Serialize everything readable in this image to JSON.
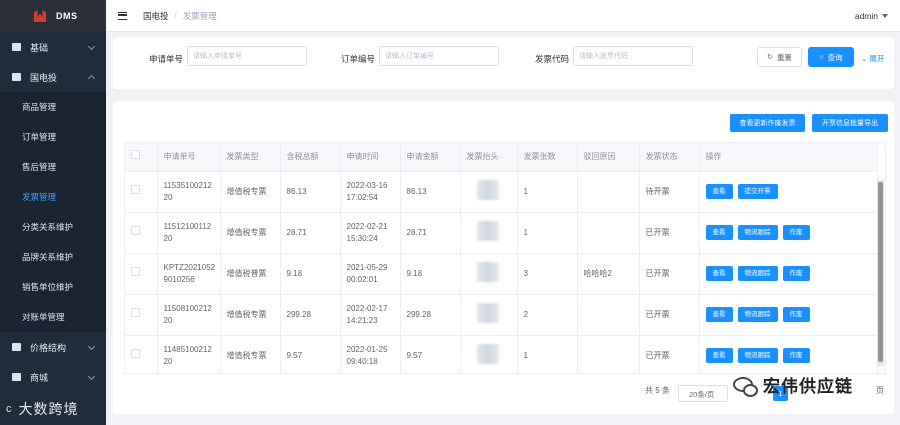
{
  "app": {
    "logo_text": "DMS"
  },
  "sidebar": {
    "menu": [
      {
        "label": "基础",
        "expanded": false
      },
      {
        "label": "国电投",
        "expanded": true
      }
    ],
    "submenu": [
      {
        "label": "商品管理",
        "active": false
      },
      {
        "label": "订单管理",
        "active": false
      },
      {
        "label": "售后管理",
        "active": false
      },
      {
        "label": "发票管理",
        "active": true
      },
      {
        "label": "分类关系维护",
        "active": false
      },
      {
        "label": "品牌关系维护",
        "active": false
      },
      {
        "label": "销售单位维护",
        "active": false
      },
      {
        "label": "对账单管理",
        "active": false
      }
    ],
    "menu_after": [
      {
        "label": "价格结构",
        "expanded": false
      },
      {
        "label": "商城",
        "expanded": false
      }
    ]
  },
  "header": {
    "breadcrumb": [
      "国电投",
      "发票管理"
    ],
    "user": "admin"
  },
  "search": {
    "fields": [
      {
        "label": "申请单号",
        "placeholder": "请输入申请单号"
      },
      {
        "label": "订单编号",
        "placeholder": "请输入订单编号"
      },
      {
        "label": "发票代码",
        "placeholder": "请输入发票代码"
      }
    ],
    "reset_label": "重置",
    "search_label": "查询",
    "expand_label": "展开"
  },
  "toolbar": {
    "btn_change_invoice": "查看更新作废发票",
    "btn_export": "开票信息批量导出"
  },
  "table": {
    "columns": [
      "申请单号",
      "发票类型",
      "含税总额",
      "申请时间",
      "申请金额",
      "发票抬头",
      "发票张数",
      "驳回原因",
      "发票状态",
      "操作"
    ],
    "rows": [
      {
        "apply_no": "1153510021220",
        "type": "增值税专票",
        "total": "86.13",
        "time": "2022-03-16 17:02:54",
        "amount": "86.13",
        "count": "1",
        "reject": "",
        "status": "待开票",
        "actions": [
          "查看",
          "提交开票"
        ]
      },
      {
        "apply_no": "1151210011220",
        "type": "增值税专票",
        "total": "28.71",
        "time": "2022-02-21 15:30:24",
        "amount": "28.71",
        "count": "1",
        "reject": "",
        "status": "已开票",
        "actions": [
          "查看",
          "物流跟踪",
          "作废"
        ]
      },
      {
        "apply_no": "KPTZ20210529010256",
        "type": "增值税普票",
        "total": "9.18",
        "time": "2021-05-29 00:02:01",
        "amount": "9.18",
        "count": "3",
        "reject": "哈哈哈2",
        "status": "已开票",
        "actions": [
          "查看",
          "物流跟踪",
          "作废"
        ]
      },
      {
        "apply_no": "1150810021220",
        "type": "增值税专票",
        "total": "299.28",
        "time": "2022-02-17 14:21:23",
        "amount": "299.28",
        "count": "2",
        "reject": "",
        "status": "已开票",
        "actions": [
          "查看",
          "物流跟踪",
          "作废"
        ]
      },
      {
        "apply_no": "1148510021220",
        "type": "增值税专票",
        "total": "9.57",
        "time": "2022-01-25 09:40:18",
        "amount": "9.57",
        "count": "1",
        "reject": "",
        "status": "已开票",
        "actions": [
          "查看",
          "物流跟踪",
          "作废"
        ]
      }
    ]
  },
  "pagination": {
    "total_label": "共 5 条",
    "page_size": "20条/页",
    "current_page": "1",
    "goto_suffix": "页"
  },
  "watermarks": {
    "left_badge": "c",
    "left_text": "大数跨境",
    "right_text": "宏伟供应链"
  }
}
